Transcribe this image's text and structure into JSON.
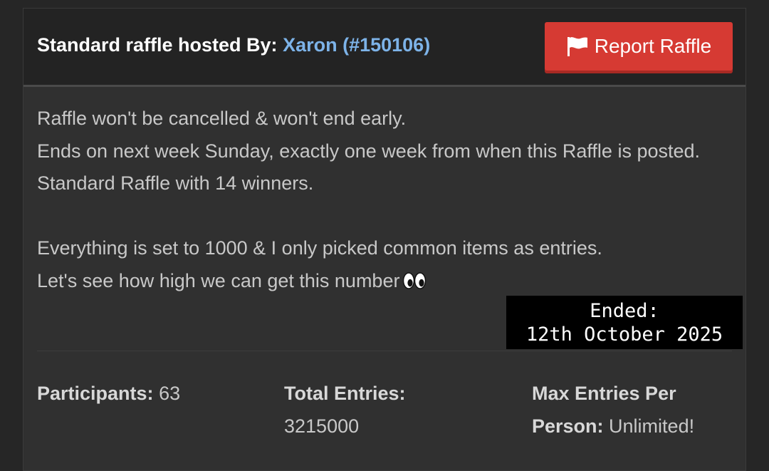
{
  "header": {
    "title_prefix": "Standard raffle hosted By:",
    "host": "Xaron (#150106)",
    "report_label": "Report Raffle",
    "report_icon": "flag-icon",
    "report_color": "#d63a33",
    "host_color": "#7db3e8"
  },
  "description": {
    "line1": "Raffle won't be cancelled & won't end early.",
    "line2": "Ends on next week Sunday, exactly one week from when this Raffle is posted.",
    "line3": "Standard Raffle with 14 winners.",
    "line4": "Everything is set to 1000 & I only picked common items as entries.",
    "line5": "Let's see how high we can get this number",
    "line5_icon": "eyes-icon"
  },
  "ended": {
    "label": "Ended:",
    "date": "12th October 2025"
  },
  "stats": {
    "participants_label": "Participants:",
    "participants_value": "63",
    "total_entries_label": "Total Entries:",
    "total_entries_value": "3215000",
    "max_entries_label": "Max Entries Per Person:",
    "max_entries_value": "Unlimited!"
  }
}
